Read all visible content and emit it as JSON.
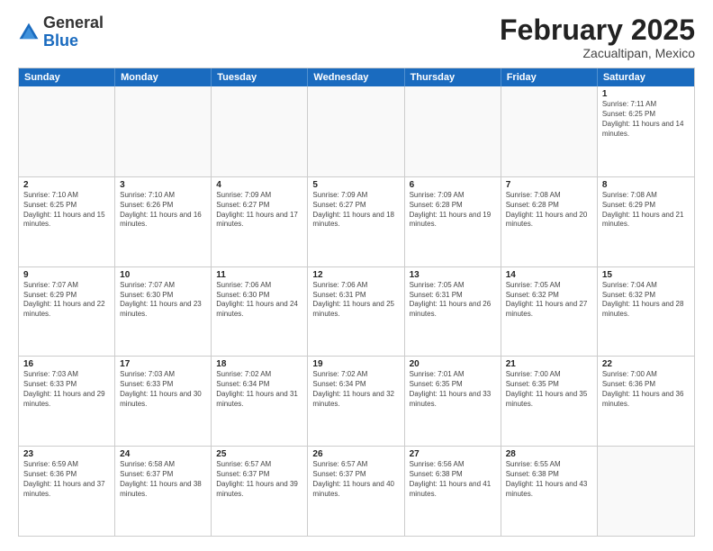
{
  "header": {
    "logo": {
      "line1": "General",
      "line2": "Blue"
    },
    "title": "February 2025",
    "location": "Zacualtipan, Mexico"
  },
  "weekdays": [
    "Sunday",
    "Monday",
    "Tuesday",
    "Wednesday",
    "Thursday",
    "Friday",
    "Saturday"
  ],
  "weeks": [
    [
      {
        "day": "",
        "info": ""
      },
      {
        "day": "",
        "info": ""
      },
      {
        "day": "",
        "info": ""
      },
      {
        "day": "",
        "info": ""
      },
      {
        "day": "",
        "info": ""
      },
      {
        "day": "",
        "info": ""
      },
      {
        "day": "1",
        "info": "Sunrise: 7:11 AM\nSunset: 6:25 PM\nDaylight: 11 hours and 14 minutes."
      }
    ],
    [
      {
        "day": "2",
        "info": "Sunrise: 7:10 AM\nSunset: 6:25 PM\nDaylight: 11 hours and 15 minutes."
      },
      {
        "day": "3",
        "info": "Sunrise: 7:10 AM\nSunset: 6:26 PM\nDaylight: 11 hours and 16 minutes."
      },
      {
        "day": "4",
        "info": "Sunrise: 7:09 AM\nSunset: 6:27 PM\nDaylight: 11 hours and 17 minutes."
      },
      {
        "day": "5",
        "info": "Sunrise: 7:09 AM\nSunset: 6:27 PM\nDaylight: 11 hours and 18 minutes."
      },
      {
        "day": "6",
        "info": "Sunrise: 7:09 AM\nSunset: 6:28 PM\nDaylight: 11 hours and 19 minutes."
      },
      {
        "day": "7",
        "info": "Sunrise: 7:08 AM\nSunset: 6:28 PM\nDaylight: 11 hours and 20 minutes."
      },
      {
        "day": "8",
        "info": "Sunrise: 7:08 AM\nSunset: 6:29 PM\nDaylight: 11 hours and 21 minutes."
      }
    ],
    [
      {
        "day": "9",
        "info": "Sunrise: 7:07 AM\nSunset: 6:29 PM\nDaylight: 11 hours and 22 minutes."
      },
      {
        "day": "10",
        "info": "Sunrise: 7:07 AM\nSunset: 6:30 PM\nDaylight: 11 hours and 23 minutes."
      },
      {
        "day": "11",
        "info": "Sunrise: 7:06 AM\nSunset: 6:30 PM\nDaylight: 11 hours and 24 minutes."
      },
      {
        "day": "12",
        "info": "Sunrise: 7:06 AM\nSunset: 6:31 PM\nDaylight: 11 hours and 25 minutes."
      },
      {
        "day": "13",
        "info": "Sunrise: 7:05 AM\nSunset: 6:31 PM\nDaylight: 11 hours and 26 minutes."
      },
      {
        "day": "14",
        "info": "Sunrise: 7:05 AM\nSunset: 6:32 PM\nDaylight: 11 hours and 27 minutes."
      },
      {
        "day": "15",
        "info": "Sunrise: 7:04 AM\nSunset: 6:32 PM\nDaylight: 11 hours and 28 minutes."
      }
    ],
    [
      {
        "day": "16",
        "info": "Sunrise: 7:03 AM\nSunset: 6:33 PM\nDaylight: 11 hours and 29 minutes."
      },
      {
        "day": "17",
        "info": "Sunrise: 7:03 AM\nSunset: 6:33 PM\nDaylight: 11 hours and 30 minutes."
      },
      {
        "day": "18",
        "info": "Sunrise: 7:02 AM\nSunset: 6:34 PM\nDaylight: 11 hours and 31 minutes."
      },
      {
        "day": "19",
        "info": "Sunrise: 7:02 AM\nSunset: 6:34 PM\nDaylight: 11 hours and 32 minutes."
      },
      {
        "day": "20",
        "info": "Sunrise: 7:01 AM\nSunset: 6:35 PM\nDaylight: 11 hours and 33 minutes."
      },
      {
        "day": "21",
        "info": "Sunrise: 7:00 AM\nSunset: 6:35 PM\nDaylight: 11 hours and 35 minutes."
      },
      {
        "day": "22",
        "info": "Sunrise: 7:00 AM\nSunset: 6:36 PM\nDaylight: 11 hours and 36 minutes."
      }
    ],
    [
      {
        "day": "23",
        "info": "Sunrise: 6:59 AM\nSunset: 6:36 PM\nDaylight: 11 hours and 37 minutes."
      },
      {
        "day": "24",
        "info": "Sunrise: 6:58 AM\nSunset: 6:37 PM\nDaylight: 11 hours and 38 minutes."
      },
      {
        "day": "25",
        "info": "Sunrise: 6:57 AM\nSunset: 6:37 PM\nDaylight: 11 hours and 39 minutes."
      },
      {
        "day": "26",
        "info": "Sunrise: 6:57 AM\nSunset: 6:37 PM\nDaylight: 11 hours and 40 minutes."
      },
      {
        "day": "27",
        "info": "Sunrise: 6:56 AM\nSunset: 6:38 PM\nDaylight: 11 hours and 41 minutes."
      },
      {
        "day": "28",
        "info": "Sunrise: 6:55 AM\nSunset: 6:38 PM\nDaylight: 11 hours and 43 minutes."
      },
      {
        "day": "",
        "info": ""
      }
    ]
  ]
}
